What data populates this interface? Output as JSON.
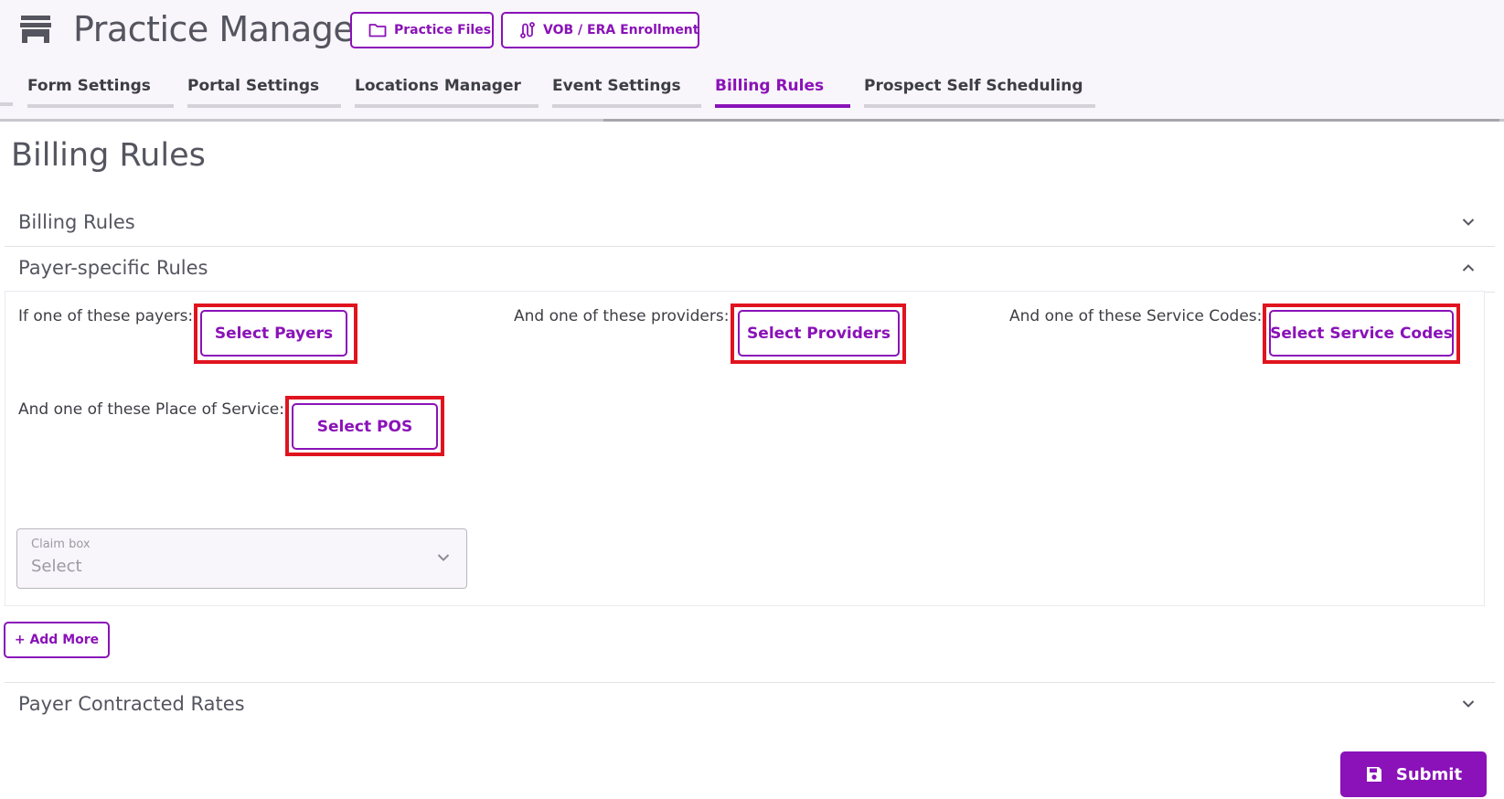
{
  "header": {
    "app_title": "Practice Manager",
    "app_icon": "store-icon",
    "buttons": [
      {
        "label": "Practice Files",
        "icon": "folder-icon"
      },
      {
        "label": "VOB / ERA Enrollment",
        "icon": "route-icon"
      }
    ]
  },
  "tabs": [
    {
      "label": "Form Settings",
      "active": false
    },
    {
      "label": "Portal Settings",
      "active": false
    },
    {
      "label": "Locations Manager",
      "active": false
    },
    {
      "label": "Event Settings",
      "active": false
    },
    {
      "label": "Billing Rules",
      "active": true
    },
    {
      "label": "Prospect Self Scheduling",
      "active": false
    }
  ],
  "page": {
    "title": "Billing Rules"
  },
  "sections": {
    "billing_rules": {
      "title": "Billing Rules",
      "expanded": false
    },
    "payer_specific_rules": {
      "title": "Payer-specific Rules",
      "expanded": true
    },
    "payer_contracted_rates": {
      "title": "Payer Contracted Rates",
      "expanded": false
    }
  },
  "rules": {
    "payers_label": "If one of these payers:",
    "payers_button": "Select Payers",
    "providers_label": "And one of these providers:",
    "providers_button": "Select Providers",
    "service_codes_label": "And one of these Service Codes:",
    "service_codes_button": "Select Service Codes",
    "pos_label": "And one of these Place of Service:",
    "pos_button": "Select POS"
  },
  "claim_box": {
    "label": "Claim box",
    "value": "Select"
  },
  "actions": {
    "add_more": "+ Add More",
    "submit": "Submit"
  },
  "colors": {
    "accent": "#8a12b8",
    "highlight": "#e0141f",
    "header_bg": "#f8f6fa"
  }
}
